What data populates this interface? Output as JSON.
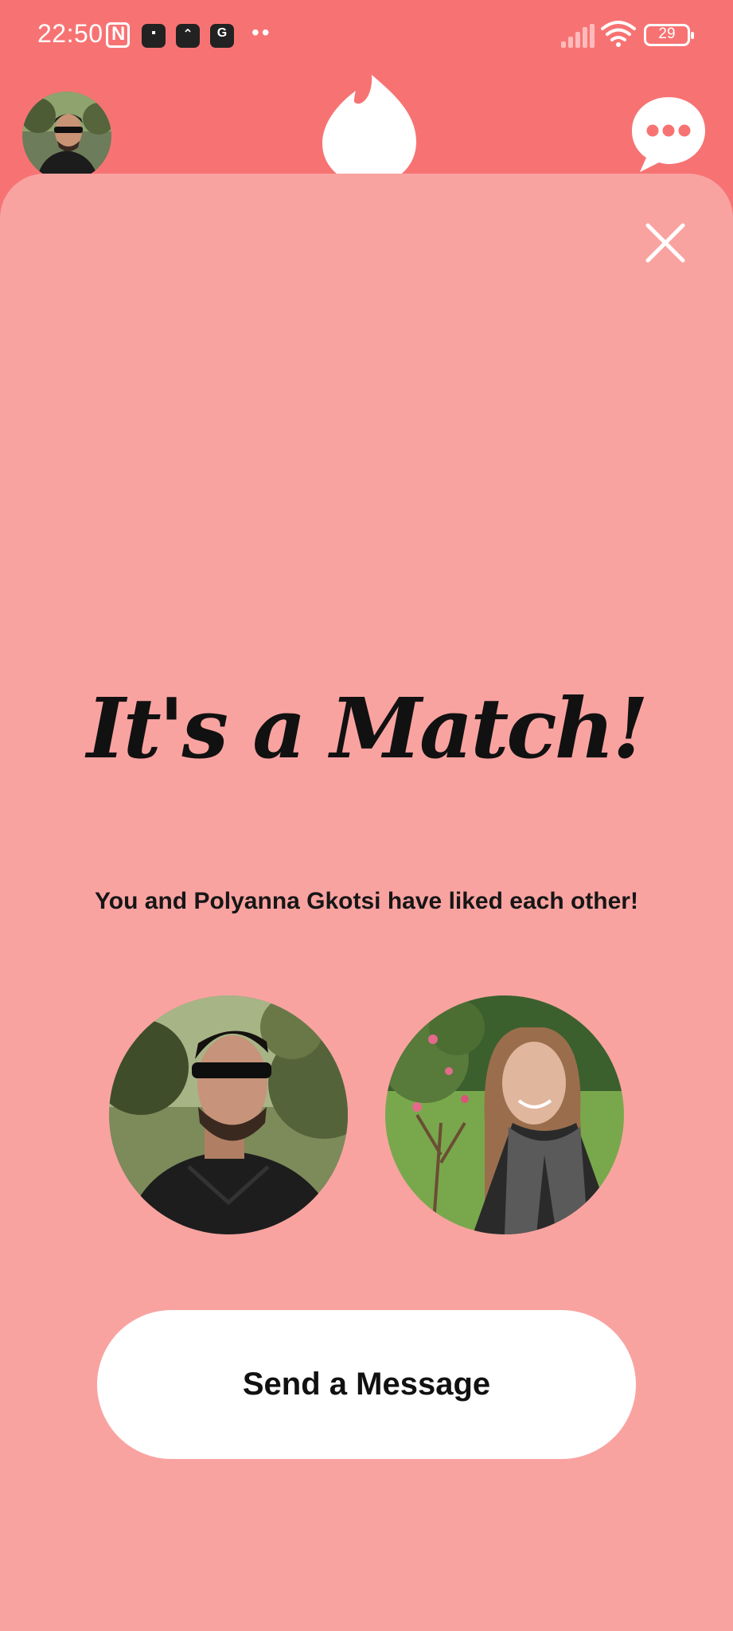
{
  "status_bar": {
    "time": "22:50",
    "battery": "29",
    "app_icons": [
      "message-app-icon",
      "clock-app-icon",
      "google-app-icon"
    ],
    "extra_indicator": "••"
  },
  "header": {
    "flame_icon": "flame-icon",
    "chat_icon": "chat-bubble-icon"
  },
  "match": {
    "title": "It's a Match!",
    "subtitle": "You and Polyanna Gkotsi have liked each other!",
    "send_button_label": "Send a Message"
  },
  "colors": {
    "header_bg": "#f77373",
    "card_bg": "#f9a3a1",
    "button_bg": "#ffffff",
    "text": "#111111"
  }
}
